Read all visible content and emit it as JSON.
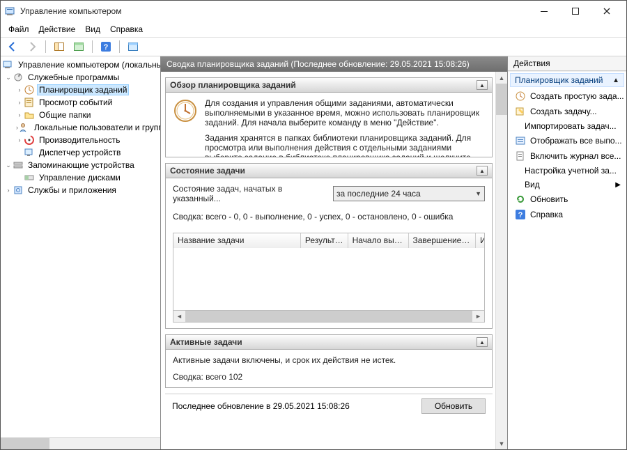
{
  "window": {
    "title": "Управление компьютером"
  },
  "menubar": {
    "file": "Файл",
    "action": "Действие",
    "view": "Вид",
    "help": "Справка"
  },
  "tree": {
    "root": "Управление компьютером (локальным",
    "sys_tools": "Служебные программы",
    "task_sched": "Планировщик заданий",
    "event_viewer": "Просмотр событий",
    "shared": "Общие папки",
    "local_users": "Локальные пользователи и группы",
    "perf": "Производительность",
    "devmgr": "Диспетчер устройств",
    "storage": "Запоминающие устройства",
    "diskmgmt": "Управление дисками",
    "services": "Службы и приложения"
  },
  "mid": {
    "header": "Сводка планировщика заданий (Последнее обновление: 29.05.2021 15:08:26)",
    "overview": {
      "title": "Обзор планировщика заданий",
      "p1": "Для создания и управления общими заданиями, автоматически выполняемыми в указанное время, можно использовать планировщик заданий. Для начала выберите команду в меню \"Действие\".",
      "p2": "Задания хранятся в папках библиотеки планировщика заданий. Для просмотра или выполнения действия с отдельными заданиями выберите задание в библиотеке планировщика заданий и щелкните команду в меню"
    },
    "status": {
      "title": "Состояние задачи",
      "started_label": "Состояние задач, начатых в указанный...",
      "period_options": [
        "за последние 24 часа"
      ],
      "period_selected": "за последние 24 часа",
      "summary": "Сводка: всего - 0, 0 - выполнение, 0 - успех, 0 - остановлено, 0 - ошибка",
      "cols": {
        "name": "Название задачи",
        "result": "Результат...",
        "start": "Начало выпо...",
        "end": "Завершение в...",
        "i": "И"
      }
    },
    "active": {
      "title": "Активные задачи",
      "desc": "Активные задачи включены, и срок их действия не истек.",
      "summary": "Сводка: всего 102"
    },
    "footer": {
      "last_update": "Последнее обновление в 29.05.2021 15:08:26",
      "refresh": "Обновить"
    }
  },
  "actions": {
    "header": "Действия",
    "subheader": "Планировщик заданий",
    "items": {
      "create_basic": "Создать простую зада...",
      "create_task": "Создать задачу...",
      "import": "Импортировать задач...",
      "show_running": "Отображать все выпо...",
      "enable_log": "Включить журнал все...",
      "at_account": "Настройка учетной за...",
      "view": "Вид",
      "refresh": "Обновить",
      "help": "Справка"
    }
  }
}
